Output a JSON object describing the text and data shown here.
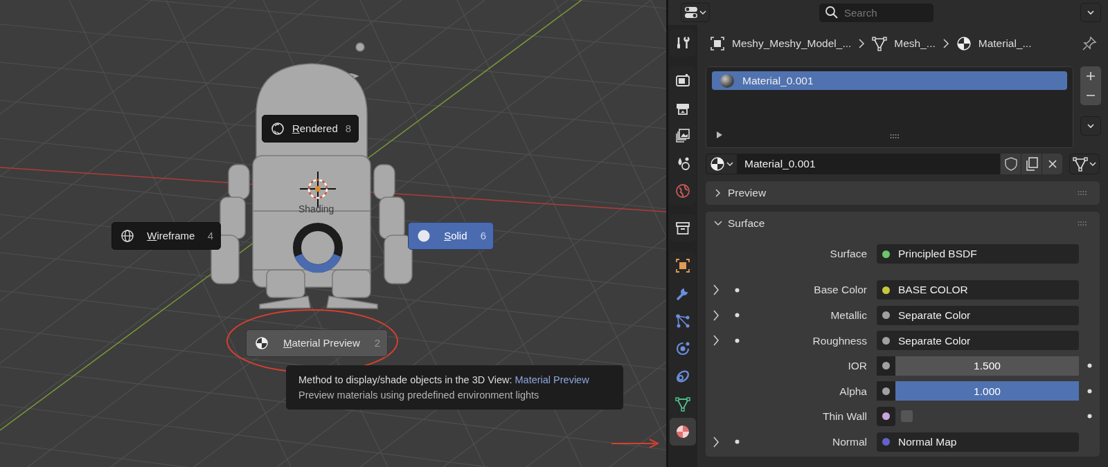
{
  "viewport": {
    "pie_menu": {
      "title": "Shading",
      "items": [
        {
          "kind": "rendered",
          "label": "Rendered",
          "shortcut": "8",
          "selected": false,
          "highlighted": false
        },
        {
          "kind": "wireframe",
          "label": "Wireframe",
          "shortcut": "4",
          "selected": false,
          "highlighted": false
        },
        {
          "kind": "solid",
          "label": "Solid",
          "shortcut": "6",
          "selected": true,
          "highlighted": false
        },
        {
          "kind": "material",
          "label": "Material Preview",
          "shortcut": "2",
          "selected": false,
          "highlighted": true
        }
      ]
    },
    "tooltip": {
      "text": "Method to display/shade objects in the 3D View: ",
      "highlight": "Material Preview",
      "description": "Preview materials using predefined environment lights"
    }
  },
  "properties": {
    "search": {
      "placeholder": "Search"
    },
    "tab_groups": [
      [
        {
          "kind": "tool",
          "selected": false
        }
      ],
      [
        {
          "kind": "render",
          "selected": false
        },
        {
          "kind": "output",
          "selected": false
        },
        {
          "kind": "view_layer",
          "selected": false
        },
        {
          "kind": "scene",
          "selected": false
        },
        {
          "kind": "world",
          "selected": false
        }
      ],
      [
        {
          "kind": "collection",
          "selected": false
        }
      ],
      [
        {
          "kind": "object",
          "selected": false
        },
        {
          "kind": "modifier",
          "selected": false
        },
        {
          "kind": "particles",
          "selected": false
        },
        {
          "kind": "physics",
          "selected": false
        },
        {
          "kind": "constraints",
          "selected": false
        },
        {
          "kind": "data",
          "selected": false
        },
        {
          "kind": "material",
          "selected": true
        }
      ]
    ],
    "breadcrumb": [
      {
        "kind": "object",
        "label": "Meshy_Meshy_Model_..."
      },
      {
        "kind": "mesh",
        "label": "Mesh_..."
      },
      {
        "kind": "material",
        "label": "Material_..."
      }
    ],
    "material_slots": [
      {
        "name": "Material_0.001",
        "selected": true
      }
    ],
    "material_field": {
      "value": "Material_0.001"
    },
    "sections": [
      {
        "title": "Preview",
        "expanded": false
      },
      {
        "title": "Surface",
        "expanded": true,
        "rows": [
          {
            "kind": "link",
            "label": "Surface",
            "value": "Principled BSDF",
            "color": "#6cc46c",
            "expandable": false
          },
          {
            "kind": "link",
            "label": "Base Color",
            "value": "BASE COLOR",
            "color": "#c7c73f",
            "expandable": true
          },
          {
            "kind": "link",
            "label": "Metallic",
            "value": "Separate Color",
            "color": "#a1a1a1",
            "expandable": true
          },
          {
            "kind": "link",
            "label": "Roughness",
            "value": "Separate Color",
            "color": "#a1a1a1",
            "expandable": true
          },
          {
            "kind": "number",
            "label": "IOR",
            "value": "1.500",
            "color": "#a1a1a1",
            "expandable": false
          },
          {
            "kind": "slider",
            "label": "Alpha",
            "value": "1.000",
            "color": "#a1a1a1",
            "expandable": false,
            "level": 1.0
          },
          {
            "kind": "checkbox",
            "label": "Thin Wall",
            "color": "#c9a3d9",
            "expandable": false,
            "checked": false
          },
          {
            "kind": "link",
            "label": "Normal",
            "value": "Normal Map",
            "color": "#6363c7",
            "expandable": true
          }
        ]
      }
    ]
  }
}
